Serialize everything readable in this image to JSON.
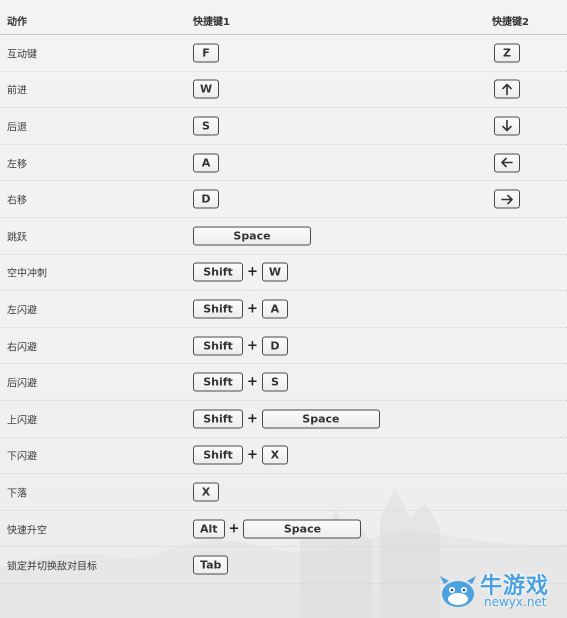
{
  "header": {
    "col_action": "动作",
    "col_key1": "快捷键1",
    "col_key2": "快捷键2"
  },
  "plus_symbol": "+",
  "rows": [
    {
      "action": "互动键",
      "k1": [
        "F"
      ],
      "k2": "Z"
    },
    {
      "action": "前进",
      "k1": [
        "W"
      ],
      "k2_icon": "arrow-up-icon"
    },
    {
      "action": "后退",
      "k1": [
        "S"
      ],
      "k2_icon": "arrow-down-icon"
    },
    {
      "action": "左移",
      "k1": [
        "A"
      ],
      "k2_icon": "arrow-left-icon"
    },
    {
      "action": "右移",
      "k1": [
        "D"
      ],
      "k2_icon": "arrow-right-icon"
    },
    {
      "action": "跳跃",
      "k1": [
        "Space"
      ]
    },
    {
      "action": "空中冲刺",
      "k1": [
        "Shift",
        "W"
      ]
    },
    {
      "action": "左闪避",
      "k1": [
        "Shift",
        "A"
      ]
    },
    {
      "action": "右闪避",
      "k1": [
        "Shift",
        "D"
      ]
    },
    {
      "action": "后闪避",
      "k1": [
        "Shift",
        "S"
      ]
    },
    {
      "action": "上闪避",
      "k1": [
        "Shift",
        "Space"
      ]
    },
    {
      "action": "下闪避",
      "k1": [
        "Shift",
        "X"
      ]
    },
    {
      "action": "下落",
      "k1": [
        "X"
      ]
    },
    {
      "action": "快速升空",
      "k1": [
        "Alt",
        "Space"
      ]
    },
    {
      "action": "锁定并切换敌对目标",
      "k1": [
        "Tab"
      ]
    }
  ],
  "watermark": {
    "name": "牛游戏",
    "url": "newyx.net",
    "icon": "cow-mascot-icon",
    "color": "#4aa3e0"
  }
}
